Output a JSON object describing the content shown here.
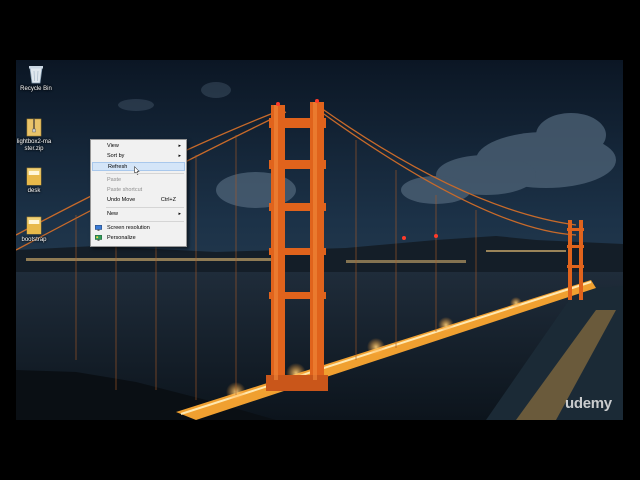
{
  "desktop": {
    "icons": [
      {
        "label": "Recycle Bin",
        "icon": "recycle-bin-icon"
      },
      {
        "label": "lightbox2-ma ster.zip",
        "icon": "zip-folder-icon"
      },
      {
        "label": "desk",
        "icon": "folder-icon"
      },
      {
        "label": "bootstrap",
        "icon": "folder-icon"
      }
    ]
  },
  "context_menu": {
    "items": [
      {
        "label": "View",
        "submenu": true
      },
      {
        "label": "Sort by",
        "submenu": true
      },
      {
        "label": "Refresh",
        "highlighted": true
      },
      {
        "label": "Paste",
        "disabled": true
      },
      {
        "label": "Paste shortcut",
        "disabled": true
      },
      {
        "label": "Undo Move",
        "shortcut": "Ctrl+Z"
      },
      {
        "label": "New",
        "submenu": true
      },
      {
        "label": "Screen resolution",
        "icon": "screen-resolution-icon"
      },
      {
        "label": "Personalize",
        "icon": "personalize-icon"
      }
    ],
    "submenu_glyph": "▸"
  },
  "watermark": "udemy",
  "colors": {
    "menu_highlight": "#d4e5f8",
    "bridge": "#e0631c",
    "sky": "#0e1a2a"
  }
}
